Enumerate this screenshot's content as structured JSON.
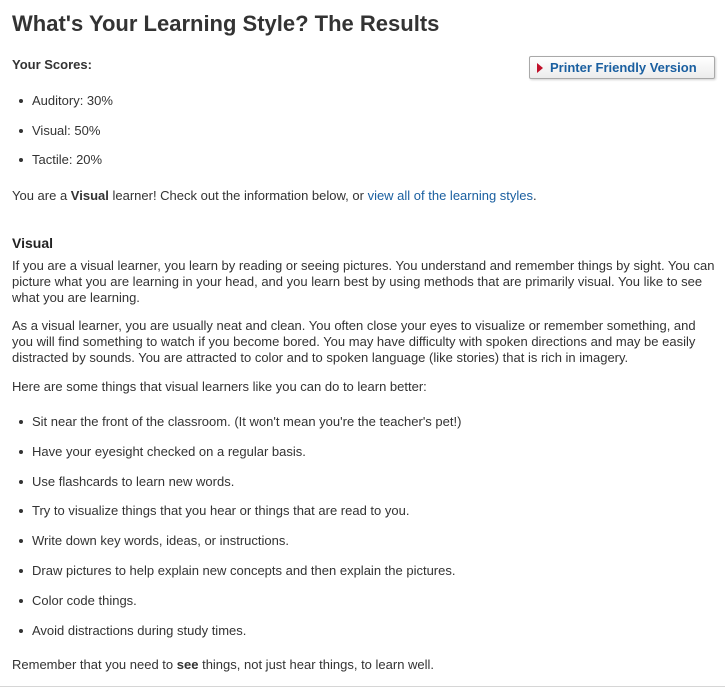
{
  "title": "What's Your Learning Style? The Results",
  "scores": {
    "label": "Your Scores:",
    "items": [
      {
        "text": "Auditory: 30%"
      },
      {
        "text": "Visual: 50%"
      },
      {
        "text": "Tactile: 20%"
      }
    ]
  },
  "printer_button": {
    "label": "Printer Friendly Version"
  },
  "result": {
    "prefix": "You are a ",
    "style": "Visual",
    "middle": " learner! Check out the information below, or ",
    "link": "view all of the learning styles",
    "suffix": "."
  },
  "section": {
    "heading": "Visual",
    "para1": "If you are a visual learner, you learn by reading or seeing pictures. You understand and remember things by sight. You can picture what you are learning in your head, and you learn best by using methods that are primarily visual. You like to see what you are learning.",
    "para2": "As a visual learner, you are usually neat and clean. You often close your eyes to visualize or remember something, and you will find something to watch if you become bored. You may have difficulty with spoken directions and may be easily distracted by sounds. You are attracted to color and to spoken language (like stories) that is rich in imagery.",
    "para3": "Here are some things that visual learners like you can do to learn better:",
    "tips": [
      {
        "text": "Sit near the front of the classroom. (It won't mean you're the teacher's pet!)"
      },
      {
        "text": "Have your eyesight checked on a regular basis."
      },
      {
        "text": "Use flashcards to learn new words."
      },
      {
        "text": "Try to visualize things that you hear or things that are read to you."
      },
      {
        "text": "Write down key words, ideas, or instructions."
      },
      {
        "text": "Draw pictures to help explain new concepts and then explain the pictures."
      },
      {
        "text": "Color code things."
      },
      {
        "text": "Avoid distractions during study times."
      }
    ],
    "closing": {
      "prefix": "Remember that you need to ",
      "emphasis": "see",
      "suffix": " things, not just hear things, to learn well."
    }
  }
}
